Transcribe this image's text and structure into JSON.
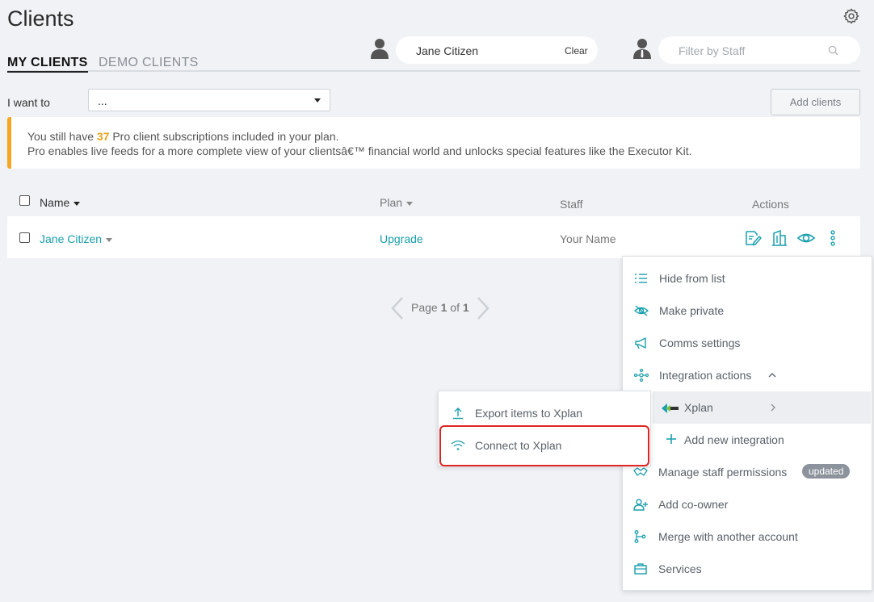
{
  "page": {
    "title": "Clients"
  },
  "tabs": {
    "my_clients": "MY CLIENTS",
    "demo_clients": "DEMO CLIENTS"
  },
  "client_filter": {
    "value": "Jane Citizen",
    "clear_label": "Clear"
  },
  "staff_filter": {
    "placeholder": "Filter by Staff"
  },
  "action_bar": {
    "i_want_to": "I want to",
    "select_value": "...",
    "add_clients": "Add clients"
  },
  "banner": {
    "line1_pre": "You still have ",
    "count": "37",
    "line1_post": " Pro client subscriptions included in your plan.",
    "line2": "Pro enables live feeds for a more complete view of your clientsâ€™ financial world and unlocks special features like the Executor Kit."
  },
  "table": {
    "headers": {
      "name": "Name",
      "plan": "Plan",
      "staff": "Staff",
      "actions": "Actions"
    },
    "rows": [
      {
        "name": "Jane Citizen",
        "plan": "Upgrade",
        "staff": "Your Name"
      }
    ]
  },
  "pager": {
    "prefix": "Page ",
    "current": "1",
    "middle": " of ",
    "total": "1"
  },
  "context_menu": {
    "items": [
      {
        "label": "Hide from list",
        "icon": "list-icon"
      },
      {
        "label": "Make private",
        "icon": "eye-slash-icon"
      },
      {
        "label": "Comms settings",
        "icon": "megaphone-icon"
      },
      {
        "label": "Integration actions",
        "icon": "network-icon"
      },
      {
        "label": "Xplan",
        "icon": "xplan-logo-icon"
      },
      {
        "label": "Add new integration",
        "icon": "plus-icon"
      },
      {
        "label": "Manage staff permissions",
        "icon": "handshake-icon",
        "badge": "updated"
      },
      {
        "label": "Add co-owner",
        "icon": "user-plus-icon"
      },
      {
        "label": "Merge with another account",
        "icon": "merge-icon"
      },
      {
        "label": "Services",
        "icon": "briefcase-icon"
      }
    ]
  },
  "xplan_submenu": {
    "items": [
      {
        "label": "Export items to Xplan",
        "icon": "upload-icon"
      },
      {
        "label": "Connect to Xplan",
        "icon": "wifi-icon"
      }
    ]
  },
  "colors": {
    "accent": "#1aa0ad",
    "warning": "#f5a623",
    "highlight": "#e02424"
  }
}
